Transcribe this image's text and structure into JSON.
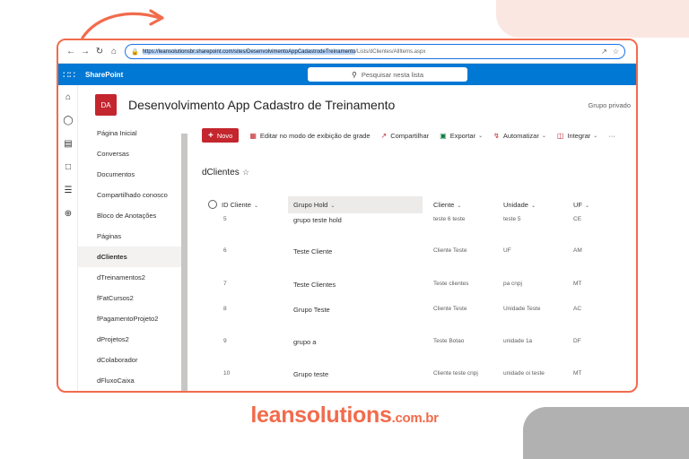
{
  "colors": {
    "accent": "#f26b4c",
    "sharepoint_blue": "#0078d4",
    "site_red": "#c4262e",
    "highlight": "#b4d5fe"
  },
  "browser": {
    "url_selected": "https://leansolutionsbr.sharepoint.com/sites/DesenvolvimentoAppCadastrodeTreinamento",
    "url_rest": "/Lists/dClientes/AllItems.aspx"
  },
  "suite_bar": {
    "brand": "SharePoint",
    "search_placeholder": "Pesquisar nesta lista"
  },
  "site": {
    "logo_text": "DA",
    "title": "Desenvolvimento App Cadastro de Treinamento",
    "type": "Grupo privado"
  },
  "nav": {
    "items": [
      "Página Inicial",
      "Conversas",
      "Documentos",
      "Compartilhado conosco",
      "Bloco de Anotações",
      "Páginas",
      "dClientes",
      "dTreinamentos2",
      "fFatCursos2",
      "fPagamentoProjeto2",
      "dProjetos2",
      "dColaborador",
      "dFluxoCaixa"
    ],
    "active_index": 6
  },
  "commands": {
    "new": "Novo",
    "edit_grid": "Editar no modo de exibição de grade",
    "share": "Compartilhar",
    "export": "Exportar",
    "automate": "Automatizar",
    "integrate": "Integrar",
    "more": "···"
  },
  "list": {
    "title": "dClientes",
    "columns": [
      "ID Cliente",
      "Grupo Hold",
      "Cliente",
      "Unidade",
      "UF"
    ],
    "sorted_column": 1,
    "rows": [
      [
        "5",
        "grupo teste hold",
        "teste 6 teste",
        "teste 5",
        "CE"
      ],
      [
        "6",
        "Teste Cliente",
        "Cliente Teste",
        "UF",
        "AM"
      ],
      [
        "7",
        "Teste Clientes",
        "Teste clientes",
        "pa cnpj",
        "MT"
      ],
      [
        "8",
        "Grupo Teste",
        "Cliente Teste",
        "Unidade Teste",
        "AC"
      ],
      [
        "9",
        "grupo a",
        "Teste Botao",
        "unidade 1a",
        "DF"
      ],
      [
        "10",
        "Grupo teste",
        "Cliente teste cnpj",
        "unidade oi teste",
        "MT"
      ]
    ]
  },
  "footer": {
    "brand": "leansolutions",
    "domain": ".com.br"
  },
  "icons": {
    "back": "arrow-left-icon",
    "forward": "arrow-right-icon",
    "reload": "reload-icon",
    "home": "home-icon",
    "lock": "lock-icon",
    "waffle": "app-launcher-icon",
    "search": "search-icon"
  }
}
